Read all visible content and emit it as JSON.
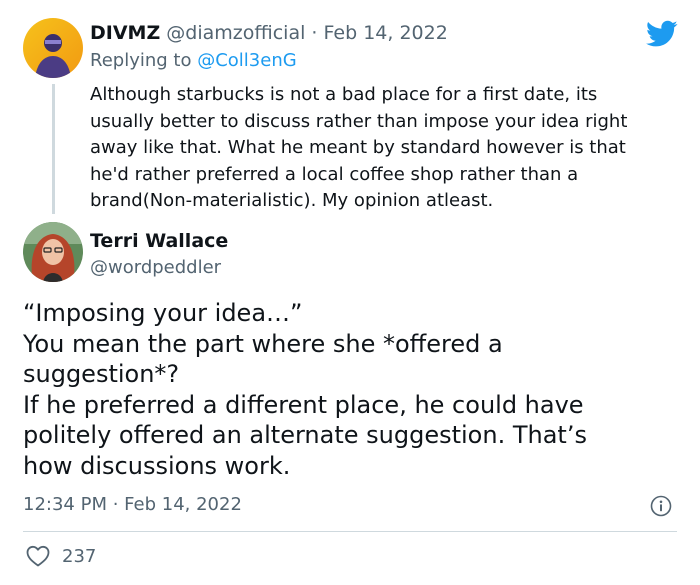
{
  "reply_tweet": {
    "display_name": "DIVMZ",
    "handle": "@diamzofficial",
    "separator": " · ",
    "date": "Feb 14, 2022",
    "replying_prefix": "Replying to ",
    "replying_handle": "@Coll3enG",
    "body_lines": [
      "Although starbucks is not a bad place for a first date, its",
      "usually better to discuss rather than impose your idea right",
      "away like that. What he meant by standard however is that",
      "he'd rather preferred a local coffee shop rather than a",
      "brand(Non-materialistic). My opinion atleast."
    ]
  },
  "main_tweet": {
    "display_name": "Terri Wallace",
    "handle": "@wordpeddler",
    "body_lines": [
      "“Imposing your idea…”",
      "You mean the part where she *offered a",
      "suggestion*?",
      "If he preferred a different place,  he could have",
      "politely offered an alternate suggestion.  That’s",
      "how discussions work."
    ],
    "time": "12:34 PM",
    "separator": " · ",
    "date": "Feb 14, 2022",
    "like_count": "237"
  },
  "icons": {
    "brand": "twitter-bird-icon",
    "info": "info-icon",
    "like": "heart-icon"
  },
  "colors": {
    "brand_blue": "#1d9bf0",
    "text": "#0f1419",
    "secondary": "#536471",
    "divider": "#cfd9de"
  }
}
